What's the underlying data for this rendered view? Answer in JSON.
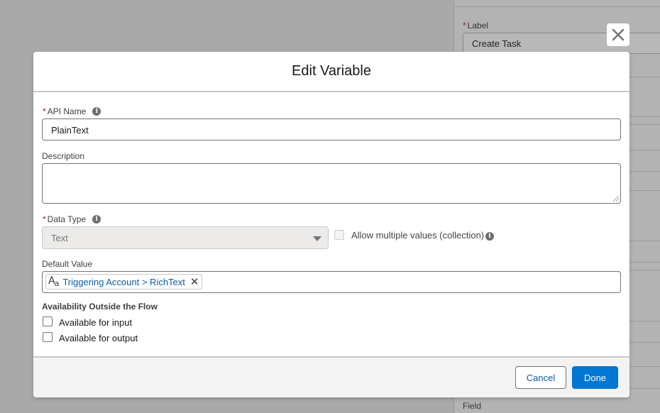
{
  "background": {
    "label_required_mark": "*",
    "label": "Label",
    "label_value": "Create Task",
    "field_label": "Field"
  },
  "modal": {
    "title": "Edit Variable",
    "api_name": {
      "required_mark": "*",
      "label": "API Name",
      "value": "PlainText"
    },
    "description": {
      "label": "Description",
      "value": ""
    },
    "data_type": {
      "required_mark": "*",
      "label": "Data Type",
      "value": "Text"
    },
    "allow_multiple": {
      "label": "Allow multiple values (collection)",
      "checked": false
    },
    "default_value": {
      "label": "Default Value",
      "pill_icon": "text-type-icon",
      "pill_label": "Triggering Account > RichText"
    },
    "availability": {
      "title": "Availability Outside the Flow",
      "input_label": "Available for input",
      "output_label": "Available for output"
    },
    "footer": {
      "cancel_label": "Cancel",
      "done_label": "Done"
    }
  },
  "colors": {
    "brand": "#0176d3",
    "link": "#0b5cab",
    "required": "#ba0517"
  }
}
